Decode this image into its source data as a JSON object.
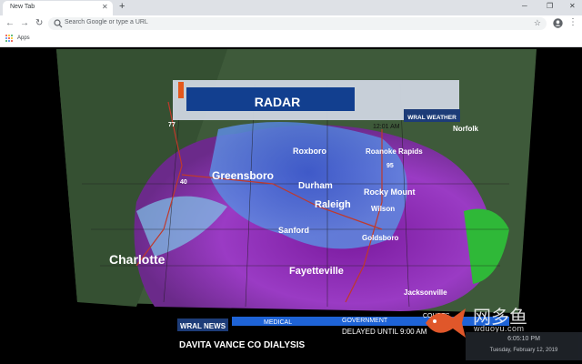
{
  "tab": {
    "title": "New Tab",
    "close_glyph": "✕"
  },
  "toolbar": {
    "newtab_glyph": "+",
    "omnibox_placeholder": "Search Google or type a URL"
  },
  "bookmarks": {
    "apps_label": "Apps"
  },
  "radar": {
    "title": "RADAR",
    "time": "12:01 AM",
    "logo": "WRAL WEATHER",
    "cities": [
      "Greensboro",
      "Roxboro",
      "Roanoke Rapids",
      "Norfolk",
      "Durham",
      "Raleigh",
      "Rocky Mount",
      "Wilson",
      "Sanford",
      "Goldsboro",
      "Charlotte",
      "Fayetteville",
      "Jacksonville"
    ],
    "highways": [
      "77",
      "40",
      "95"
    ],
    "ticker": {
      "logo": "WRAL NEWS",
      "tabs": [
        "MEDICAL",
        "GOVERNMENT",
        "COURTS"
      ],
      "status": "DELAYED UNTIL 9:00 AM",
      "headline": "DAVITA VANCE CO DIALYSIS"
    }
  },
  "watermark": {
    "text": "网多鱼",
    "domain": "wduoyu.com"
  },
  "clock": {
    "time": "6:05:10 PM",
    "date": "Tuesday, February 12, 2019"
  },
  "colors": {
    "chrome_bg": "#dee1e6",
    "accent": "#1a73e8",
    "radar_purple": "#8a2bc0",
    "radar_blue": "#3d6bd6"
  }
}
